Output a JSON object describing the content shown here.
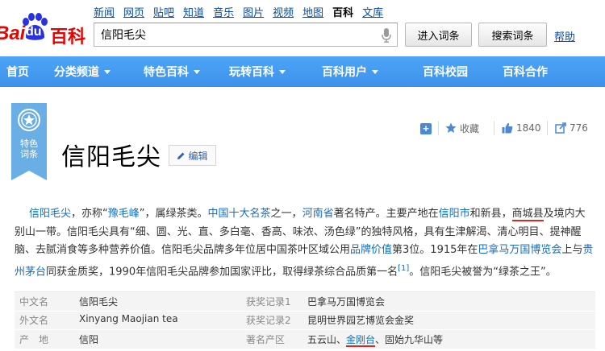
{
  "logo": {
    "bai": "Bai",
    "du": "du",
    "baike": "百科"
  },
  "topnav": [
    {
      "label": "新闻",
      "active": false
    },
    {
      "label": "网页",
      "active": false
    },
    {
      "label": "贴吧",
      "active": false
    },
    {
      "label": "知道",
      "active": false
    },
    {
      "label": "音乐",
      "active": false
    },
    {
      "label": "图片",
      "active": false
    },
    {
      "label": "视频",
      "active": false
    },
    {
      "label": "地图",
      "active": false
    },
    {
      "label": "百科",
      "active": true
    },
    {
      "label": "文库",
      "active": false
    }
  ],
  "search": {
    "value": "信阳毛尖",
    "enter_label": "进入词条",
    "search_label": "搜索词条",
    "help_label": "帮助"
  },
  "mainnav": [
    {
      "label": "首页",
      "caret": false,
      "width": 44
    },
    {
      "label": "分类频道",
      "caret": true,
      "width": 0
    },
    {
      "label": "特色百科",
      "caret": true,
      "width": 0
    },
    {
      "label": "玩转百科",
      "caret": true,
      "width": 0
    },
    {
      "label": "百科用户",
      "caret": true,
      "width": 0
    },
    {
      "label": "百科校园",
      "caret": false,
      "width": 0
    },
    {
      "label": "百科合作",
      "caret": false,
      "width": 0
    }
  ],
  "ribbon": {
    "line1": "特色",
    "line2": "词条"
  },
  "title": "信阳毛尖",
  "edit_label": "编辑",
  "actions": {
    "fav_label": "收藏",
    "like_count": "1840",
    "share_count": "776"
  },
  "summary": {
    "s1": "信阳毛尖",
    "s2": "，亦称“",
    "s3": "豫毛峰",
    "s4": "”，属绿茶类。",
    "s5": "中国十大名茶",
    "s6": "之一，",
    "s7": "河南省",
    "s8": "著名特产。主要产地在",
    "s9": "信阳市",
    "s10": "和新县，",
    "s11": "商城县",
    "s12": "及境内大别山一带。信阳毛尖具有“细、圆、光、直、多白毫、香高、味浓、汤色绿”的独特风格，具有生津解渴、清心明目、提神醒脑、去腻消食等多种营养价值。信阳毛尖品牌多年位居中国茶叶区域公用",
    "s13": "品牌价值",
    "s14": "第3位。1915年在",
    "s15": "巴拿马万国博览会",
    "s16": "上与",
    "s17": "贵州茅台",
    "s18": "同获金质奖，1990年信阳毛尖品牌参加国家评比，取得绿茶综合品质第一名",
    "ref": "[1]",
    "s19": "。信阳毛尖被誉为“绿茶之王”。"
  },
  "info": {
    "r1": {
      "n1": "中文名",
      "v1": "信阳毛尖",
      "n2": "获奖记录1",
      "v2": "巴拿马万国博览会"
    },
    "r2": {
      "n1": "外文名",
      "v1": "Xinyang Maojian tea",
      "n2": "获奖记录2",
      "v2": "昆明世界园艺博览会金奖"
    },
    "r3": {
      "n1": "产　地",
      "v1": "信阳",
      "n2": "著名产区",
      "v2a": "五云山、",
      "v2b": "金刚台",
      "v2c": "、固始九华山等"
    }
  },
  "colors": {
    "nav_blue": "#459df5",
    "link_blue": "#136ec2",
    "brand_red": "#e10602",
    "ribbon_blue": "#6aaee6"
  }
}
